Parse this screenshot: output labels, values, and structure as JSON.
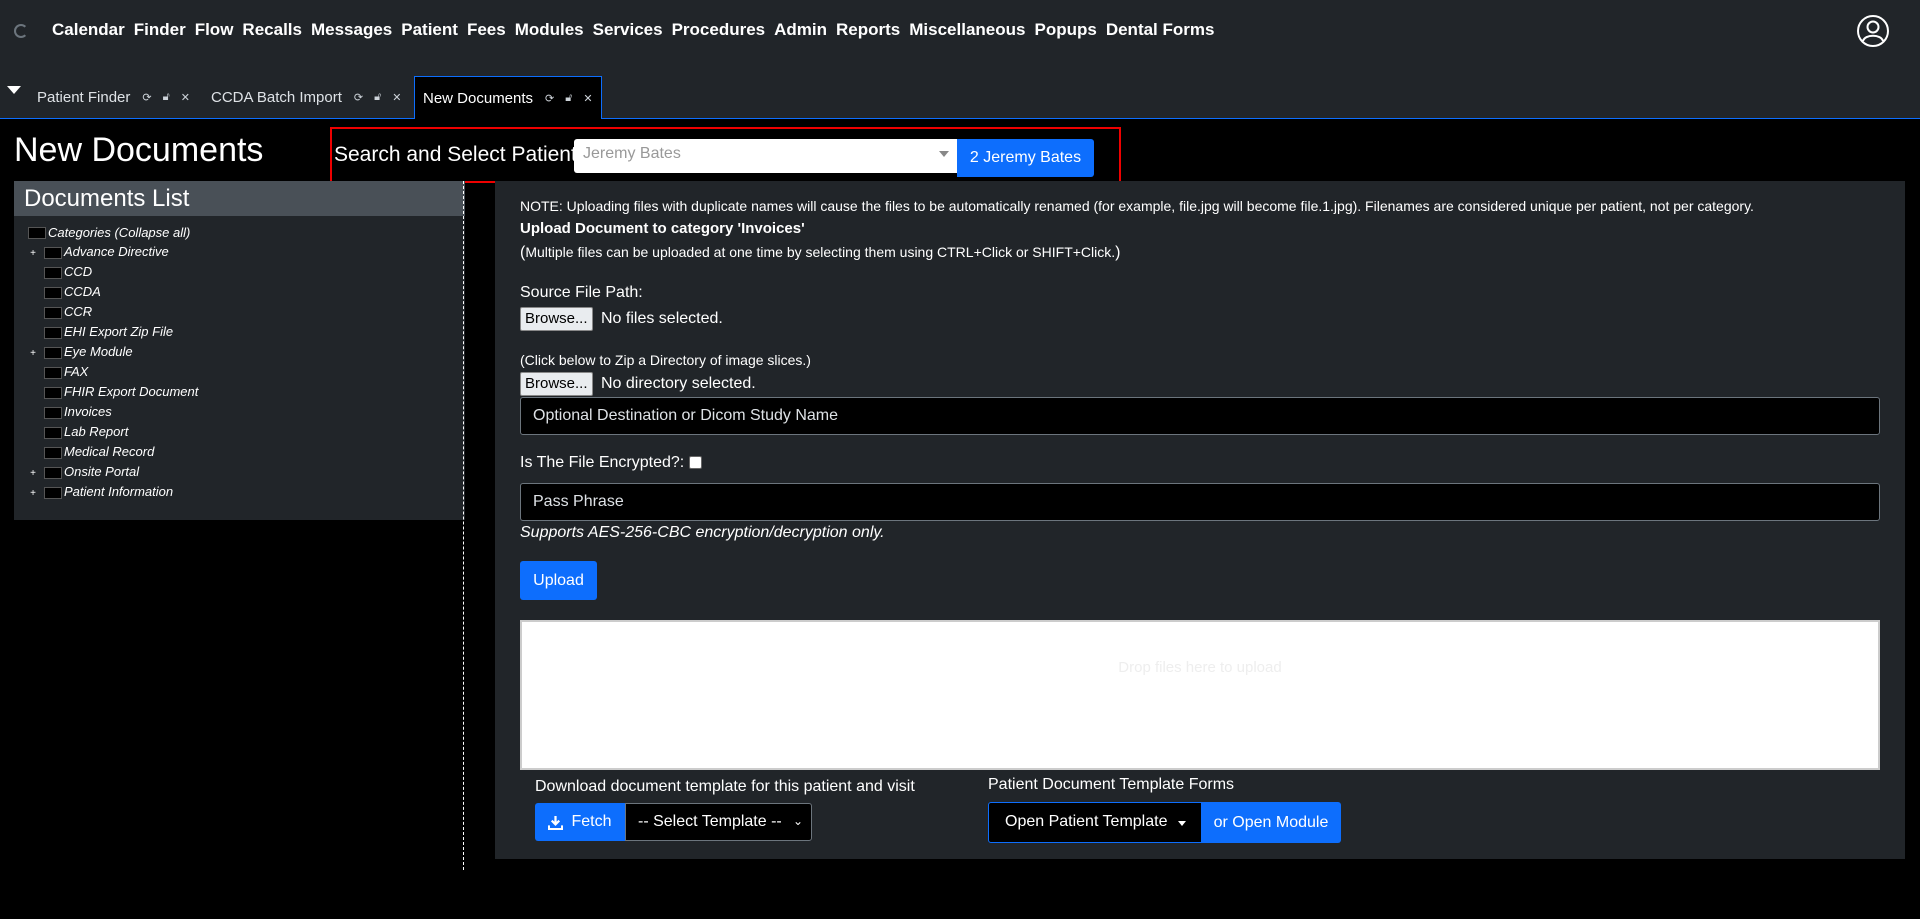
{
  "menu": [
    "Calendar",
    "Finder",
    "Flow",
    "Recalls",
    "Messages",
    "Patient",
    "Fees",
    "Modules",
    "Services",
    "Procedures",
    "Admin",
    "Reports",
    "Miscellaneous",
    "Popups",
    "Dental Forms"
  ],
  "tabs": [
    {
      "label": "Patient Finder",
      "active": false
    },
    {
      "label": "CCDA Batch Import",
      "active": false
    },
    {
      "label": "New Documents",
      "active": true
    }
  ],
  "page": {
    "title": "New Documents"
  },
  "patient_search": {
    "label": "Search and Select Patient",
    "selected": "Jeremy Bates",
    "button": "2 Jeremy Bates"
  },
  "documents_list": {
    "title": "Documents List",
    "root": "Categories (Collapse all)",
    "categories": [
      {
        "label": "Advance Directive",
        "expandable": true
      },
      {
        "label": "CCD",
        "expandable": false
      },
      {
        "label": "CCDA",
        "expandable": false
      },
      {
        "label": "CCR",
        "expandable": false
      },
      {
        "label": "EHI Export Zip File",
        "expandable": false
      },
      {
        "label": "Eye Module",
        "expandable": true
      },
      {
        "label": "FAX",
        "expandable": false
      },
      {
        "label": "FHIR Export Document",
        "expandable": false
      },
      {
        "label": "Invoices",
        "expandable": false
      },
      {
        "label": "Lab Report",
        "expandable": false
      },
      {
        "label": "Medical Record",
        "expandable": false
      },
      {
        "label": "Onsite Portal",
        "expandable": true
      },
      {
        "label": "Patient Information",
        "expandable": true
      }
    ]
  },
  "upload": {
    "note": "NOTE: Uploading files with duplicate names will cause the files to be automatically renamed (for example, file.jpg will become file.1.jpg). Filenames are considered unique per patient, not per category.",
    "heading": "Upload Document to category 'Invoices'",
    "multi_hint_open": "(",
    "multi_hint": "Multiple files can be uploaded at one time by selecting them using CTRL+Click or SHIFT+Click.",
    "multi_hint_close": ")",
    "source_label": "Source File Path:",
    "browse_label": "Browse...",
    "no_files": "No files selected.",
    "zip_hint": "(Click below to Zip a Directory of image slices.)",
    "no_directory": "No directory selected.",
    "destination_placeholder": "Optional Destination or Dicom Study Name",
    "encrypted_label": "Is The File Encrypted?:",
    "encrypted_checked": false,
    "passphrase_placeholder": "Pass Phrase",
    "encryption_note": "Supports AES-256-CBC encryption/decryption only.",
    "upload_button": "Upload",
    "dropzone_text": "Drop files here to upload"
  },
  "templates": {
    "download_label": "Download document template for this patient and visit",
    "fetch_button": "Fetch",
    "select_template": "-- Select Template --",
    "forms_label": "Patient Document Template Forms",
    "open_template": "Open Patient Template",
    "open_module": "or Open Module"
  }
}
